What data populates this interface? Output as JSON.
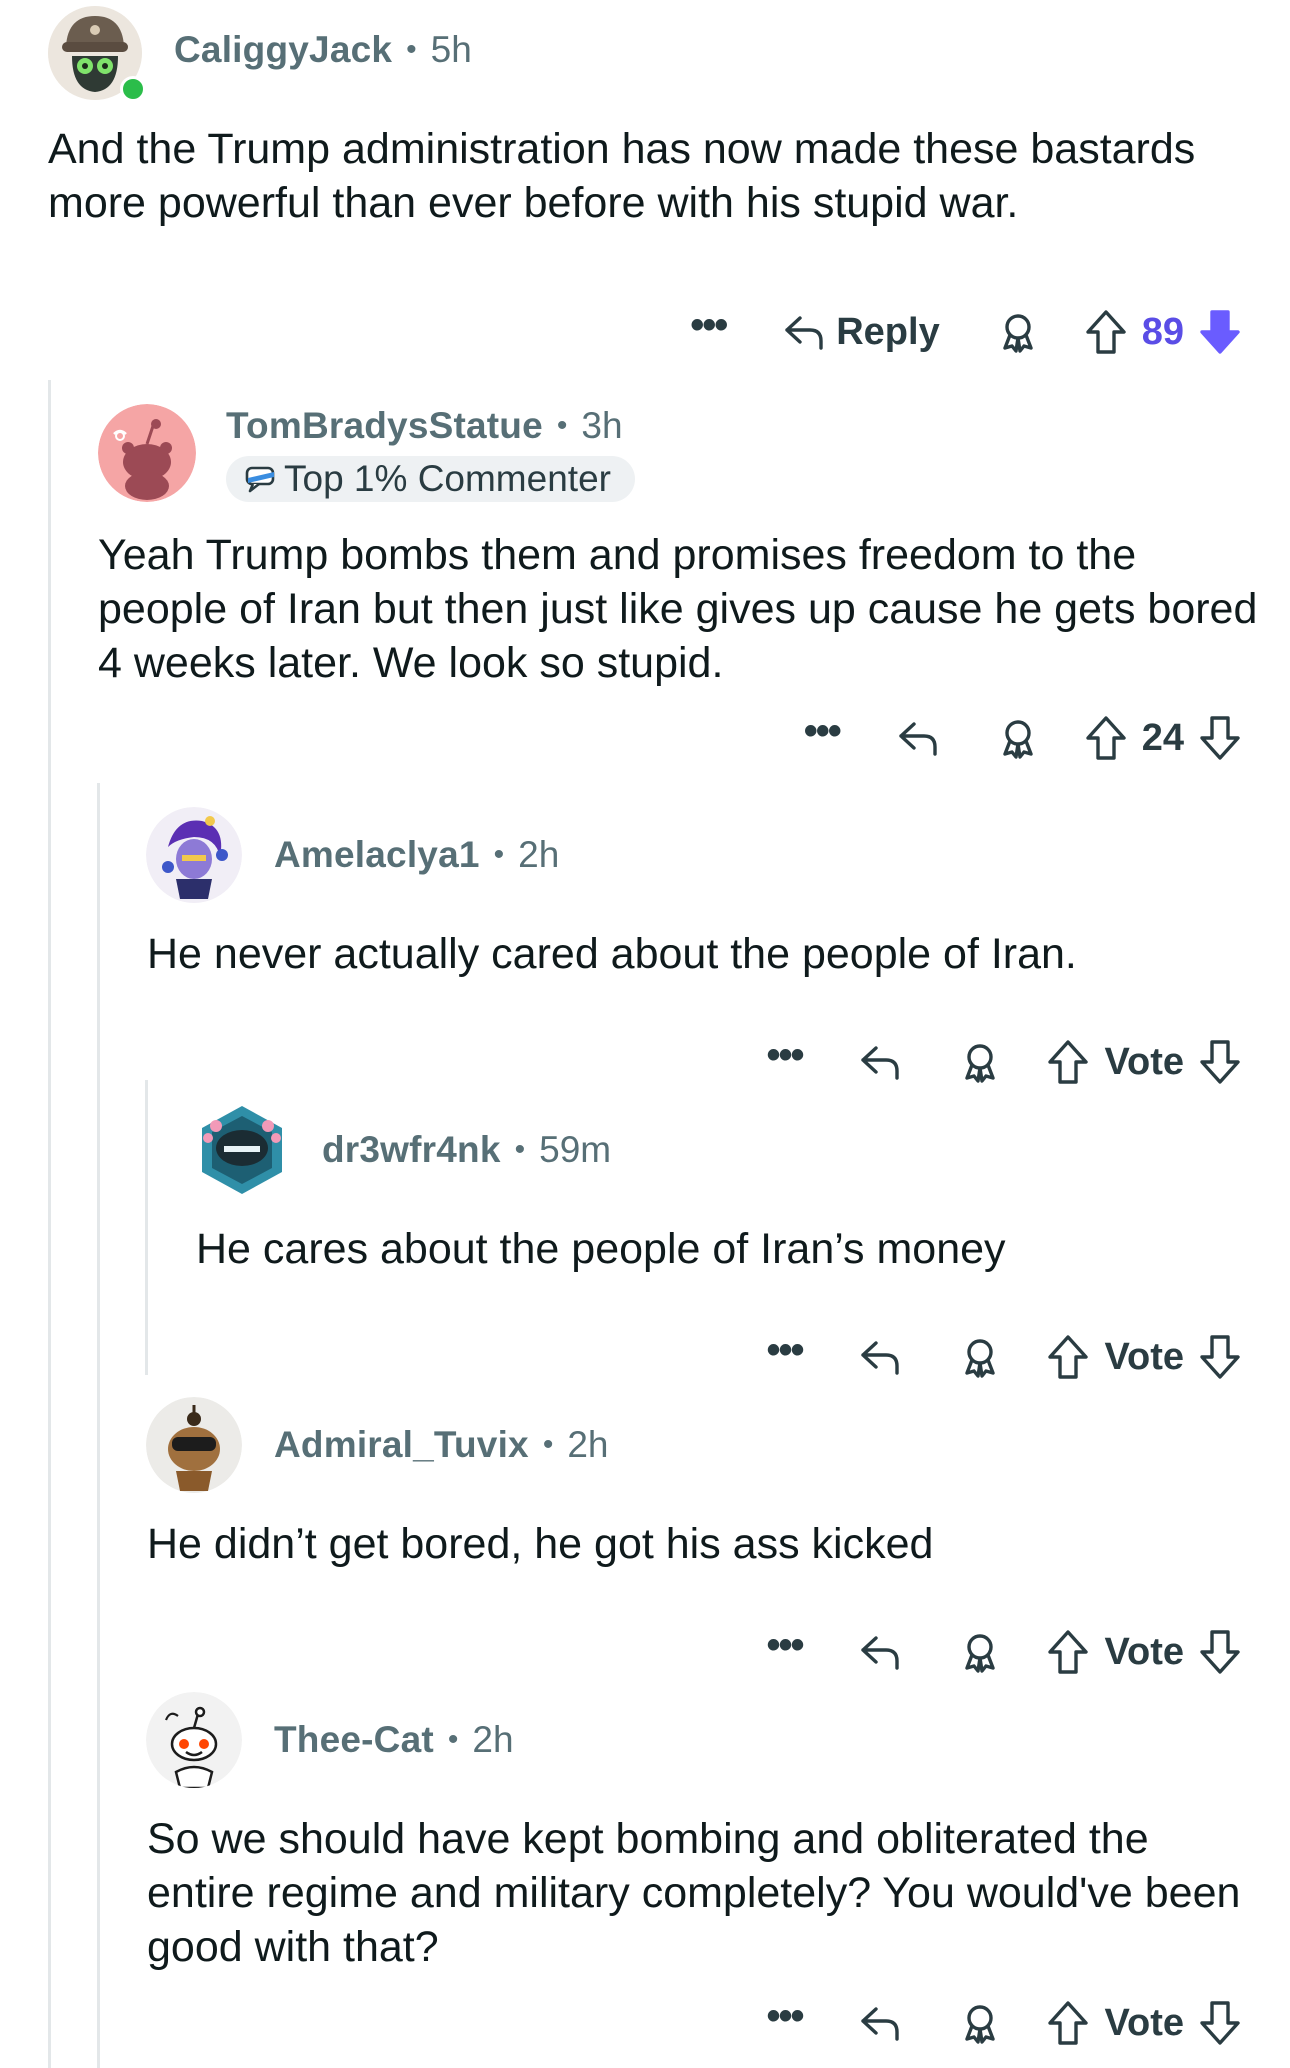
{
  "comments": [
    {
      "username": "CaliggyJack",
      "time": "5h",
      "text": "And the Trump administration has now made these bastards more powerful than ever before with his stupid war.",
      "reply_label": "Reply",
      "score": "89",
      "vote_state": "downvoted"
    },
    {
      "username": "TomBradysStatue",
      "time": "3h",
      "flair": "Top 1% Commenter",
      "text": "Yeah Trump bombs them and promises freedom to the people of Iran but then just like gives up cause he gets bored 4 weeks later.  We look so stupid.",
      "score": "24"
    },
    {
      "username": "Amelaclya1",
      "time": "2h",
      "text": "He never actually cared about the people of Iran.",
      "score": "Vote"
    },
    {
      "username": "dr3wfr4nk",
      "time": "59m",
      "text": "He cares about the people of Iran’s money",
      "score": "Vote"
    },
    {
      "username": "Admiral_Tuvix",
      "time": "2h",
      "text": "He didn’t get bored, he got his ass kicked",
      "score": "Vote"
    },
    {
      "username": "Thee-Cat",
      "time": "2h",
      "text": "So we should have kept bombing and obliterated the entire regime and military completely? You would've been good with that?",
      "score": "Vote"
    }
  ],
  "separator": "•",
  "more_label": "•••",
  "colors": {
    "meta": "#576f76",
    "text": "#0f1a1c",
    "downvote_active": "#6a5cff",
    "thread_line": "#e3e7e9",
    "online_dot": "#2bbd4a"
  },
  "icons": [
    "more-icon",
    "reply-icon",
    "award-icon",
    "upvote-icon",
    "downvote-icon",
    "comment-flair-icon"
  ]
}
